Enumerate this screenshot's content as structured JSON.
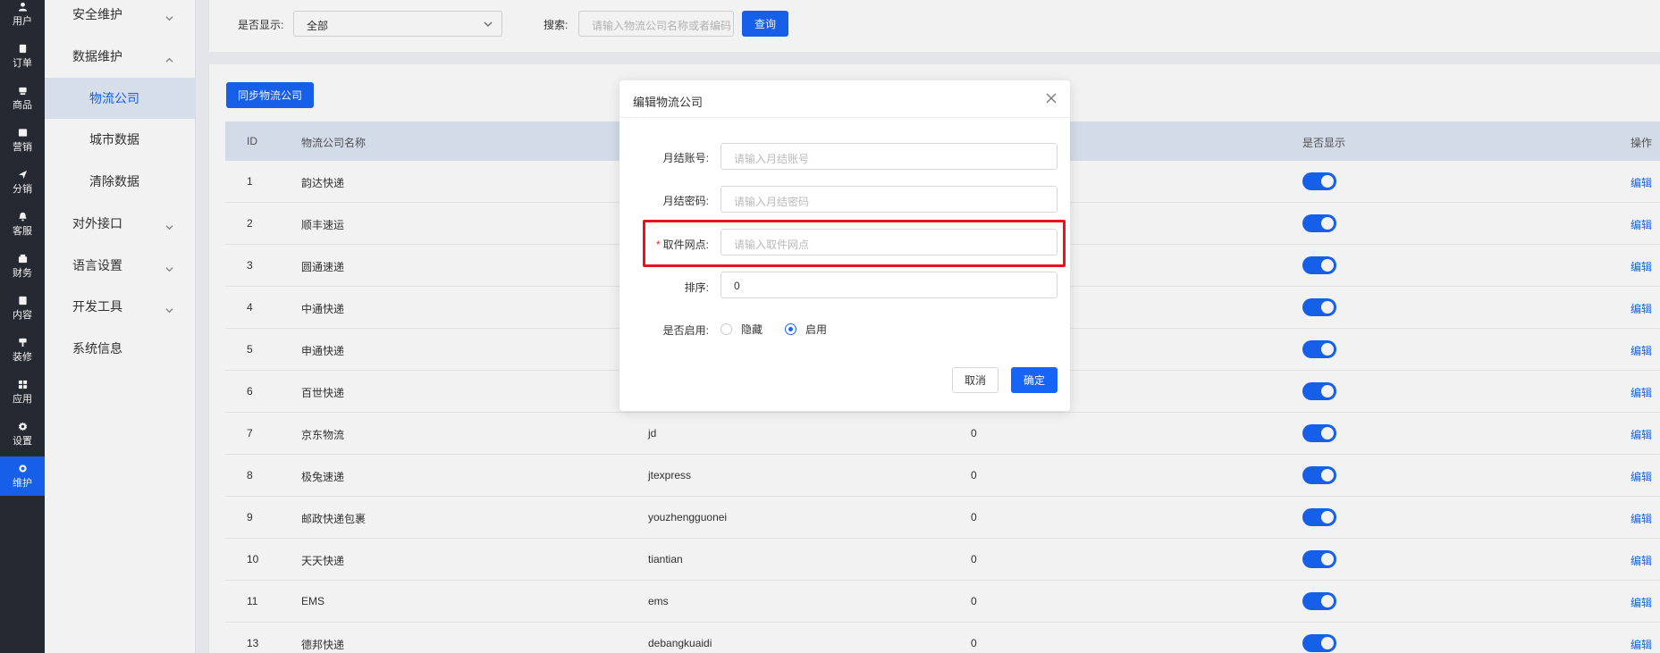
{
  "rail": [
    {
      "label": "用户",
      "icon": "user-icon",
      "active": false
    },
    {
      "label": "订单",
      "icon": "order-icon",
      "active": false
    },
    {
      "label": "商品",
      "icon": "product-icon",
      "active": false
    },
    {
      "label": "营销",
      "icon": "marketing-icon",
      "active": false
    },
    {
      "label": "分销",
      "icon": "distribution-icon",
      "active": false
    },
    {
      "label": "客服",
      "icon": "service-icon",
      "active": false
    },
    {
      "label": "财务",
      "icon": "finance-icon",
      "active": false
    },
    {
      "label": "内容",
      "icon": "content-icon",
      "active": false
    },
    {
      "label": "装修",
      "icon": "decoration-icon",
      "active": false
    },
    {
      "label": "应用",
      "icon": "apps-icon",
      "active": false
    },
    {
      "label": "设置",
      "icon": "settings-icon",
      "active": false
    },
    {
      "label": "维护",
      "icon": "maintenance-icon",
      "active": true
    }
  ],
  "submenu": {
    "security": "安全维护",
    "data": "数据维护",
    "data_items": [
      "物流公司",
      "城市数据",
      "清除数据"
    ],
    "api": "对外接口",
    "language": "语言设置",
    "devtools": "开发工具",
    "sysinfo": "系统信息"
  },
  "filter": {
    "show_label": "是否显示:",
    "show_value": "全部",
    "search_label": "搜索:",
    "search_placeholder": "请输入物流公司名称或者编码",
    "query_button": "查询"
  },
  "toolbar": {
    "sync_button": "同步物流公司"
  },
  "table": {
    "headers": {
      "id": "ID",
      "name": "物流公司名称",
      "show": "是否显示",
      "action": "操作"
    },
    "rows": [
      {
        "id": "1",
        "name": "韵达快递",
        "code": "",
        "sort": "",
        "show": true
      },
      {
        "id": "2",
        "name": "顺丰速运",
        "code": "",
        "sort": "",
        "show": true
      },
      {
        "id": "3",
        "name": "圆通速递",
        "code": "",
        "sort": "",
        "show": true
      },
      {
        "id": "4",
        "name": "中通快递",
        "code": "",
        "sort": "",
        "show": true
      },
      {
        "id": "5",
        "name": "申通快递",
        "code": "",
        "sort": "",
        "show": true
      },
      {
        "id": "6",
        "name": "百世快递",
        "code": "",
        "sort": "",
        "show": true
      },
      {
        "id": "7",
        "name": "京东物流",
        "code": "jd",
        "sort": "0",
        "show": true
      },
      {
        "id": "8",
        "name": "极兔速递",
        "code": "jtexpress",
        "sort": "0",
        "show": true
      },
      {
        "id": "9",
        "name": "邮政快递包裹",
        "code": "youzhengguonei",
        "sort": "0",
        "show": true
      },
      {
        "id": "10",
        "name": "天天快递",
        "code": "tiantian",
        "sort": "0",
        "show": true
      },
      {
        "id": "11",
        "name": "EMS",
        "code": "ems",
        "sort": "0",
        "show": true
      },
      {
        "id": "13",
        "name": "德邦快递",
        "code": "debangkuaidi",
        "sort": "0",
        "show": true
      }
    ],
    "edit_label": "编辑"
  },
  "modal": {
    "title": "编辑物流公司",
    "account_label": "月结账号:",
    "account_placeholder": "请输入月结账号",
    "password_label": "月结密码:",
    "password_placeholder": "请输入月结密码",
    "site_required": "*",
    "site_label": "取件网点:",
    "site_placeholder": "请输入取件网点",
    "sort_label": "排序:",
    "sort_value": "0",
    "enable_label": "是否启用:",
    "option_hide": "隐藏",
    "option_enable": "启用",
    "enabled": true,
    "cancel": "取消",
    "confirm": "确定"
  },
  "colors": {
    "primary": "#1765f6",
    "highlight": "#e8131d",
    "rail": "#282c34"
  }
}
